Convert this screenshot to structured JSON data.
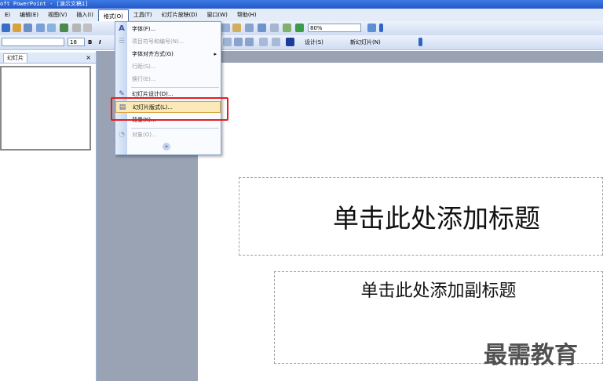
{
  "window": {
    "title": "oft PowerPoint - [演示文稿1]"
  },
  "menubar": {
    "items": [
      {
        "label": "E)"
      },
      {
        "label": "编辑(E)"
      },
      {
        "label": "视图(V)"
      },
      {
        "label": "插入(I)"
      },
      {
        "label": "格式(O)"
      },
      {
        "label": "工具(T)"
      },
      {
        "label": "幻灯片放映(D)"
      },
      {
        "label": "窗口(W)"
      },
      {
        "label": "帮助(H)"
      }
    ]
  },
  "toolbar": {
    "zoom": "80%",
    "font_size": "18",
    "bold_label": "B",
    "italic_label": "I",
    "design_label": "设计(S)",
    "new_slide_label": "新幻灯片(N)",
    "accent": "#2456c8"
  },
  "left_pane": {
    "tab_label": "幻灯片",
    "close_label": "×"
  },
  "format_menu": {
    "items": [
      {
        "label": "字体(F)...",
        "icon": "font-icon",
        "glyph": "A"
      },
      {
        "label": "项目符号和编号(N)...",
        "icon": "bullets-icon",
        "glyph": "☰",
        "disabled": true
      },
      {
        "label": "字体对齐方式(G)",
        "arrow": "▸"
      },
      {
        "label": "行距(S)...",
        "disabled": true
      },
      {
        "label": "换行(E)...",
        "disabled": true
      },
      {
        "label": "幻灯片设计(D)...",
        "icon": "design-icon",
        "glyph": "✎"
      },
      {
        "label": "幻灯片版式(L)...",
        "icon": "layout-icon",
        "glyph": "▤",
        "highlighted": true
      },
      {
        "label": "背景(K)..."
      },
      {
        "label": "对象(O)...",
        "icon": "object-icon",
        "glyph": "◔",
        "disabled": true
      }
    ],
    "more_glyph": "»"
  },
  "slide": {
    "title_placeholder": "单击此处添加标题",
    "subtitle_placeholder": "单击此处添加副标题"
  },
  "watermark": "最需教育"
}
